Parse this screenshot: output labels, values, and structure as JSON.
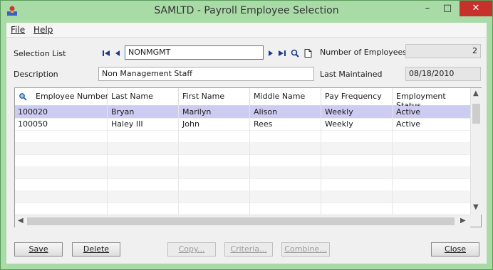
{
  "window": {
    "title": "SAMLTD - Payroll Employee Selection",
    "min_label": "–",
    "max_label": "□",
    "close_label": "✕"
  },
  "menu": {
    "file": "File",
    "help": "Help"
  },
  "form": {
    "selection_list_label": "Selection List",
    "selection_list_value": "NONMGMT",
    "description_label": "Description",
    "description_value": "Non Management Staff",
    "num_employees_label": "Number of Employees",
    "num_employees_value": "2",
    "last_maintained_label": "Last Maintained",
    "last_maintained_value": "08/18/2010"
  },
  "grid": {
    "columns": [
      "Employee Number",
      "Last Name",
      "First Name",
      "Middle Name",
      "Pay Frequency",
      "Employment Status"
    ],
    "rows": [
      [
        "100020",
        "Bryan",
        "Marilyn",
        "Alison",
        "Weekly",
        "Active"
      ],
      [
        "100050",
        "Haley III",
        "John",
        "Rees",
        "Weekly",
        "Active"
      ]
    ]
  },
  "buttons": {
    "save": "Save",
    "delete": "Delete",
    "copy": "Copy...",
    "criteria": "Criteria...",
    "combine": "Combine...",
    "close": "Close"
  },
  "icons": [
    "app-icon",
    "first-record-icon",
    "previous-record-icon",
    "next-record-icon",
    "last-record-icon",
    "finder-icon",
    "new-document-icon",
    "grid-search-icon"
  ],
  "colors": {
    "window_frame": "#a9dba7",
    "selected_row": "#ccccf2",
    "close_button": "#c7312b"
  }
}
